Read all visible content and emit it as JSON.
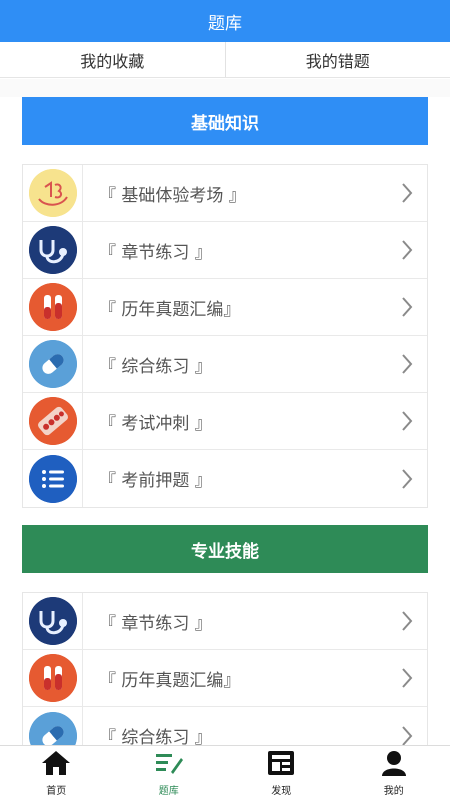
{
  "header": {
    "title": "题库"
  },
  "tabs": [
    "我的收藏",
    "我的错题"
  ],
  "sections": [
    {
      "title": "基础知识",
      "color": "#2f8ef5",
      "items": [
        {
          "label": "『 基础体验考场 』",
          "icon": "sketch-logo-icon"
        },
        {
          "label": "『 章节练习 』",
          "icon": "stethoscope-icon"
        },
        {
          "label": "『 历年真题汇编』",
          "icon": "test-tubes-icon"
        },
        {
          "label": "『 综合练习 』",
          "icon": "capsule-icon"
        },
        {
          "label": "『 考试冲刺 』",
          "icon": "pill-pack-icon"
        },
        {
          "label": "『 考前押题 』",
          "icon": "list-icon"
        }
      ]
    },
    {
      "title": "专业技能",
      "color": "#2e8b57",
      "items": [
        {
          "label": "『 章节练习 』",
          "icon": "stethoscope-icon"
        },
        {
          "label": "『 历年真题汇编』",
          "icon": "test-tubes-icon"
        },
        {
          "label": "『 综合练习 』",
          "icon": "capsule-icon"
        }
      ]
    }
  ],
  "bottom_nav": [
    {
      "label": "首页",
      "icon": "home-icon"
    },
    {
      "label": "题库",
      "icon": "question-bank-icon",
      "active": true
    },
    {
      "label": "发现",
      "icon": "discover-icon"
    },
    {
      "label": "我的",
      "icon": "profile-icon"
    }
  ]
}
